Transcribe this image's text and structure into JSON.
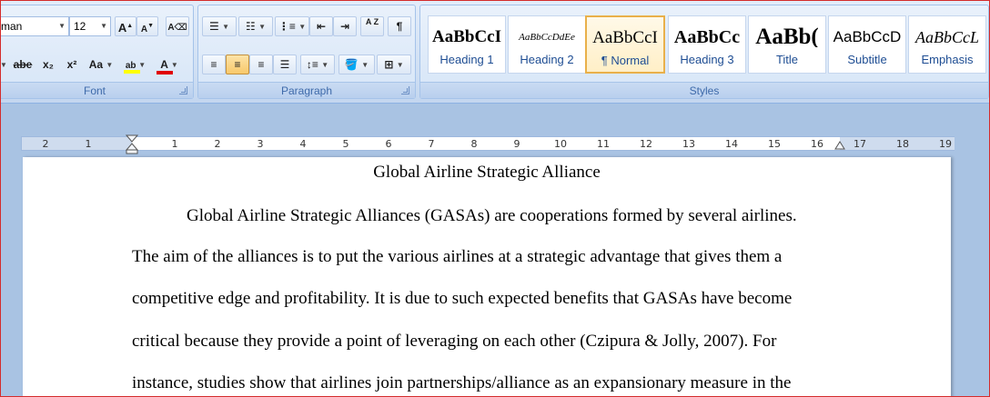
{
  "font": {
    "name_value": "man",
    "size_value": "12",
    "grow_label": "A",
    "shrink_label": "A",
    "strike_label": "abe",
    "subscript_label": "x₂",
    "superscript_label": "x²",
    "case_label": "Aa",
    "highlight_label": "ab",
    "color_label": "A",
    "group_label": "Font",
    "highlight_color": "#ffff00",
    "font_color": "#e00000"
  },
  "paragraph": {
    "group_label": "Paragraph",
    "pilcrow": "¶",
    "sort_label": "A Z"
  },
  "styles": {
    "group_label": "Styles",
    "items": [
      {
        "sample": "AaBbCcI",
        "name": "Heading 1"
      },
      {
        "sample": "AaBbCcDdEe",
        "name": "Heading 2"
      },
      {
        "sample": "AaBbCcI",
        "name": "¶ Normal"
      },
      {
        "sample": "AaBbCc",
        "name": "Heading 3"
      },
      {
        "sample": "AaBb(",
        "name": "Title"
      },
      {
        "sample": "AaBbCcD",
        "name": "Subtitle"
      },
      {
        "sample": "AaBbCcL",
        "name": "Emphasis"
      }
    ]
  },
  "ruler": {
    "left_numbers": [
      "2",
      "1"
    ],
    "right_numbers": [
      "1",
      "2",
      "3",
      "4",
      "5",
      "6",
      "7",
      "8",
      "9",
      "10",
      "11",
      "12",
      "13",
      "14",
      "15",
      "16",
      "17",
      "18",
      "19"
    ]
  },
  "document": {
    "title": "Global Airline Strategic Alliance",
    "lines": [
      "Global Airline Strategic Alliances (GASAs) are cooperations formed by several airlines.",
      "The aim of the alliances is to put the various airlines at a strategic advantage that gives them a",
      "competitive edge and profitability. It is due to such expected benefits that GASAs  have become",
      "critical because they provide a point of leveraging on each other (Czipura & Jolly, 2007). For",
      "instance, studies show that airlines join partnerships/alliance as an expansionary measure in the"
    ]
  }
}
